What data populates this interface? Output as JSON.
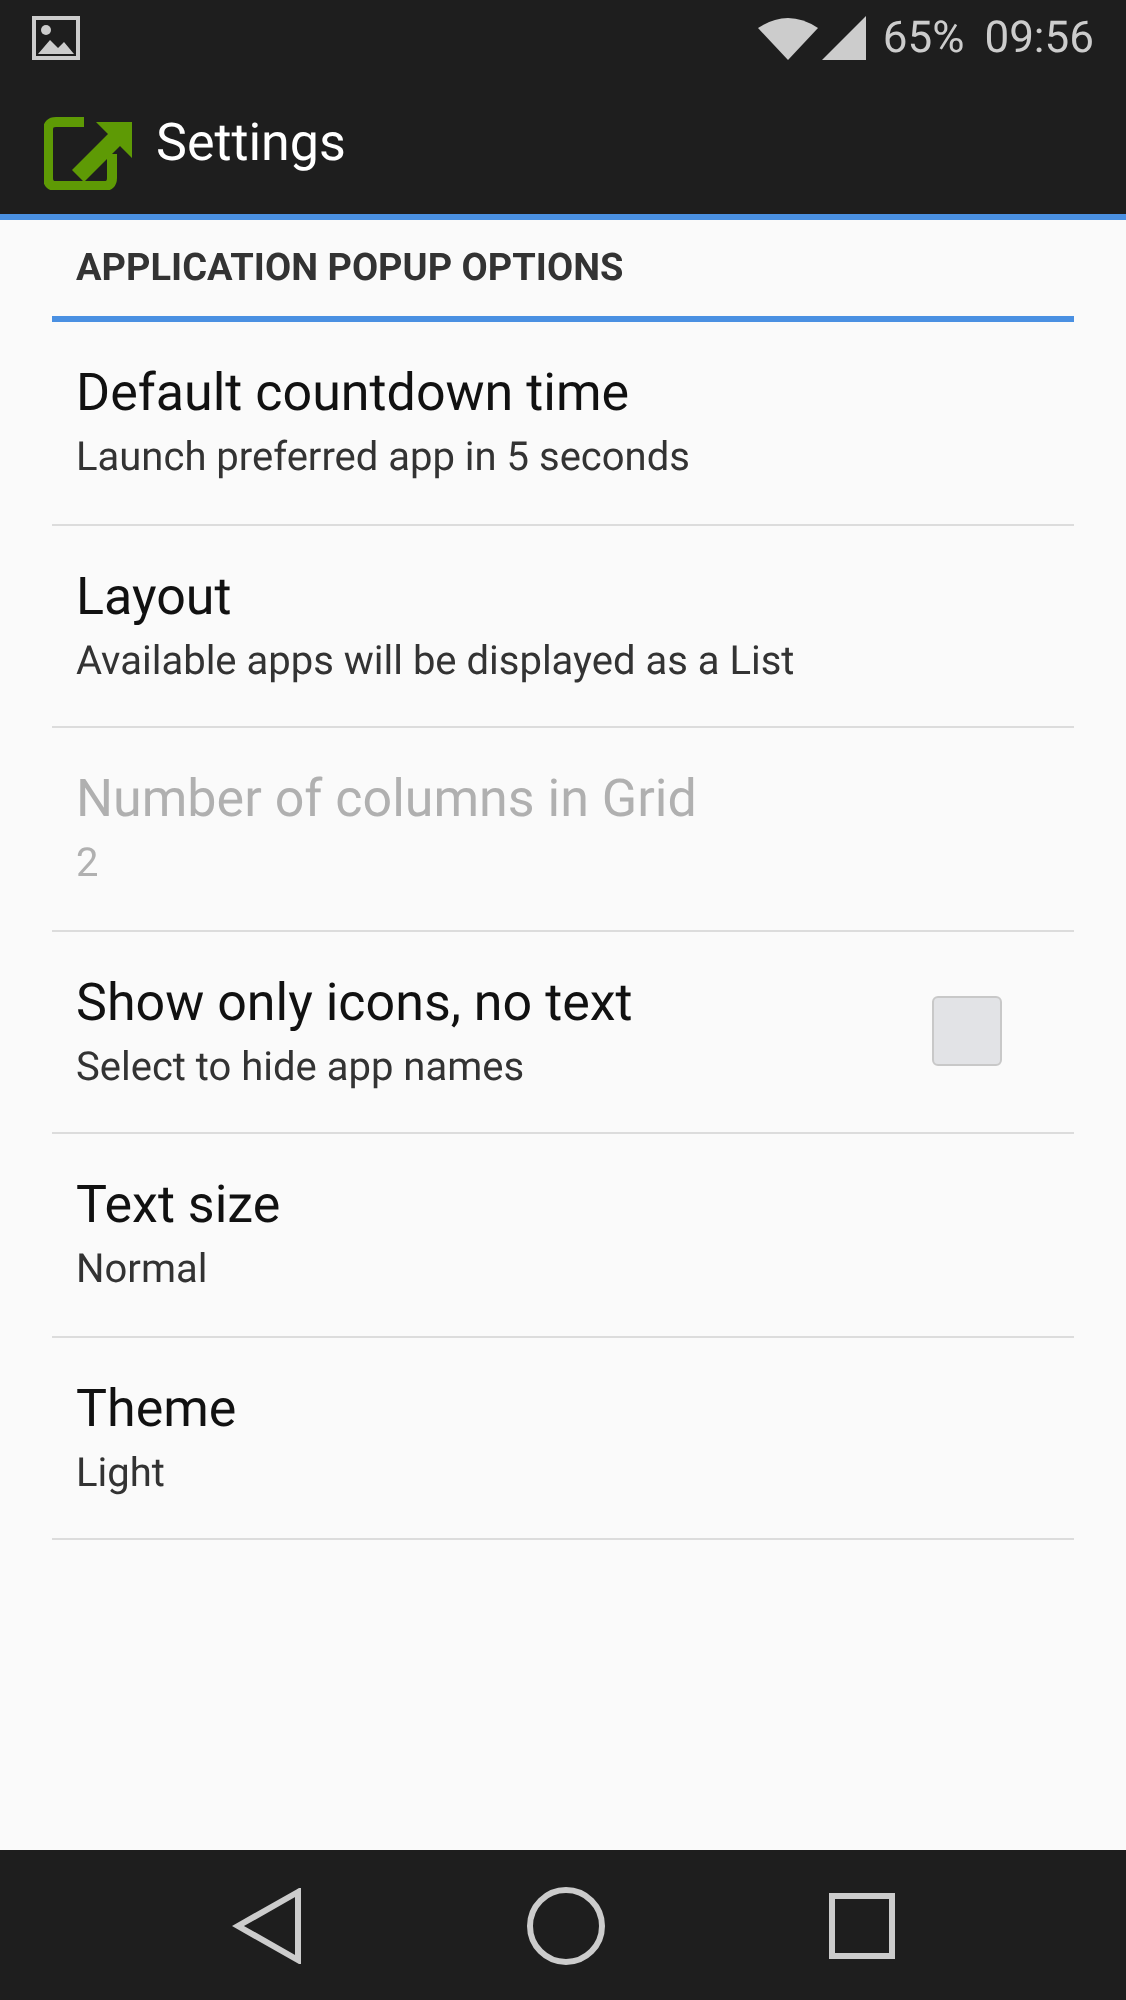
{
  "status_bar": {
    "battery": "65%",
    "time": "09:56"
  },
  "app_bar": {
    "title": "Settings"
  },
  "section": {
    "title": "APPLICATION POPUP OPTIONS"
  },
  "preferences": [
    {
      "kind": "pref",
      "title": "Default countdown time",
      "summary": "Launch preferred app in 5 seconds",
      "disabled": false
    },
    {
      "kind": "pref",
      "title": "Layout",
      "summary": "Available apps will be displayed as a List",
      "disabled": false
    },
    {
      "kind": "pref",
      "title": "Number of columns in Grid",
      "summary": "2",
      "disabled": true
    },
    {
      "kind": "checkbox",
      "title": "Show only icons, no text",
      "summary": "Select to hide app names",
      "disabled": false,
      "checked": false
    },
    {
      "kind": "pref",
      "title": "Text size",
      "summary": "Normal",
      "disabled": false
    },
    {
      "kind": "pref",
      "title": "Theme",
      "summary": "Light",
      "disabled": false
    }
  ]
}
